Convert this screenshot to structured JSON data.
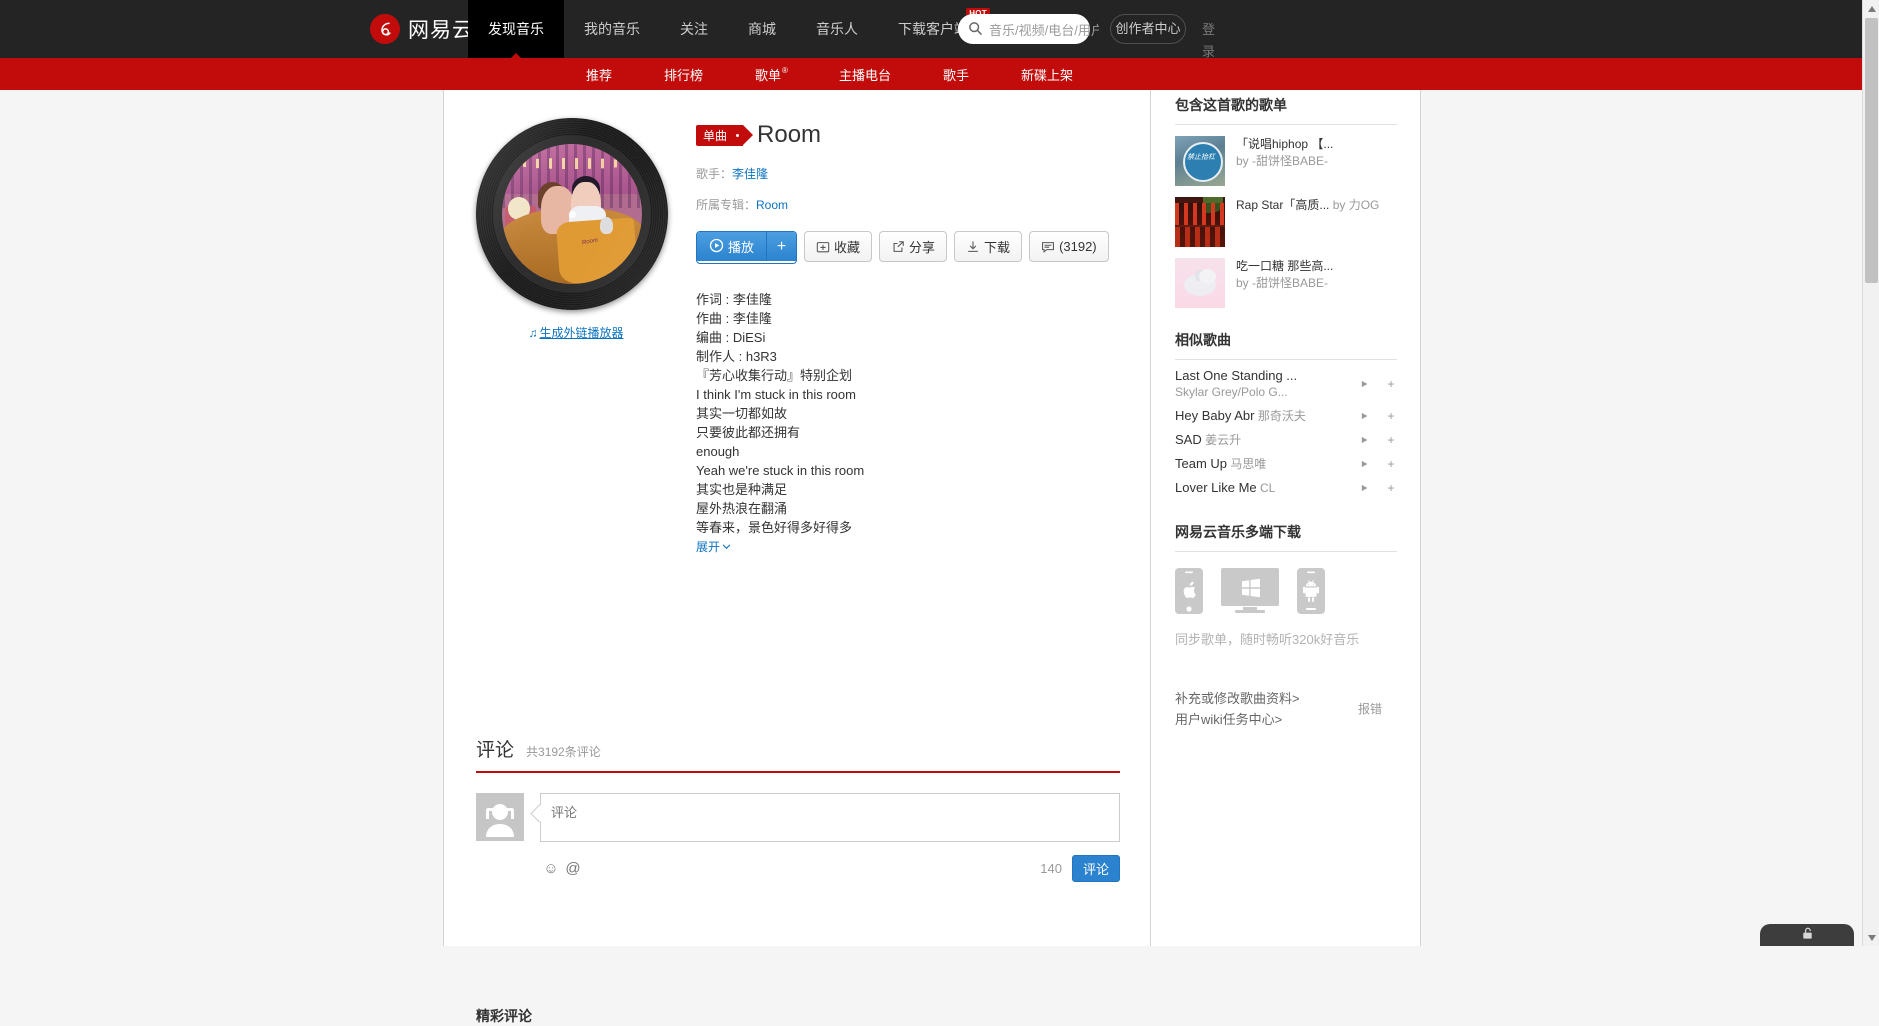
{
  "header": {
    "logo_text": "网易云音乐",
    "nav": [
      {
        "label": "发现音乐",
        "active": true,
        "hot": false
      },
      {
        "label": "我的音乐",
        "active": false,
        "hot": false
      },
      {
        "label": "关注",
        "active": false,
        "hot": false
      },
      {
        "label": "商城",
        "active": false,
        "hot": false
      },
      {
        "label": "音乐人",
        "active": false,
        "hot": false
      },
      {
        "label": "下载客户端",
        "active": false,
        "hot": true,
        "hot_label": "HOT"
      }
    ],
    "search_placeholder": "音乐/视频/电台/用户",
    "search_value": "",
    "creator_center": "创作者中心",
    "login": "登录"
  },
  "subnav": [
    {
      "label": "推荐",
      "sup": ""
    },
    {
      "label": "排行榜",
      "sup": ""
    },
    {
      "label": "歌单",
      "sup": "®"
    },
    {
      "label": "主播电台",
      "sup": ""
    },
    {
      "label": "歌手",
      "sup": ""
    },
    {
      "label": "新碟上架",
      "sup": ""
    }
  ],
  "song": {
    "tag": "单曲",
    "title": "Room",
    "artist_label": "歌手：",
    "artist": "李佳隆",
    "album_label": "所属专辑：",
    "album": "Room",
    "cover_caption": "Room",
    "outlink": "生成外链播放器",
    "outlink_icon": "music-note-icon",
    "report": "报错"
  },
  "actions": {
    "play": "播放",
    "plus": "+",
    "collect": "收藏",
    "share": "分享",
    "download": "下载",
    "comment_count": "(3192)"
  },
  "lyrics": [
    "作词 : 李佳隆",
    "作曲 : 李佳隆",
    "编曲 : DiESi",
    "制作人 : h3R3",
    "『芳心收集行动』特别企划",
    "I think I'm stuck in this room",
    "其实一切都如故",
    "只要彼此都还拥有",
    "enough",
    "Yeah we're stuck in this room",
    "其实也是种满足",
    "屋外热浪在翻涌",
    "等春来，景色好得多好得多"
  ],
  "expand_label": "展开",
  "comments": {
    "title": "评论",
    "count_text": "共3192条评论",
    "placeholder": "评论",
    "value": "",
    "char_count": "140",
    "submit": "评论",
    "emoji_icon": "emoji-icon",
    "mention_icon": "mention-at-icon",
    "hot_title": "精彩评论"
  },
  "sidebar": {
    "playlists_title": "包含这首歌的歌单",
    "playlists": [
      {
        "name": "「说唱hiphop 【...",
        "by": "by -甜饼怪BABE-",
        "cover": "c1",
        "cover_text": "禁止抬杠"
      },
      {
        "name": "Rap Star「高质...",
        "by": "by 力OG",
        "cover": "c2",
        "cover_text": ""
      },
      {
        "name": "吃一口糖 那些高...",
        "by": "by -甜饼怪BABE-",
        "cover": "c3",
        "cover_text": ""
      }
    ],
    "similar_title": "相似歌曲",
    "similar": [
      {
        "name": "Last One Standing ...",
        "artist": "Skylar Grey/Polo G..."
      },
      {
        "name": "Hey Baby Abr",
        "artist": "那奇沃夫"
      },
      {
        "name": "SAD",
        "artist": "姜云升"
      },
      {
        "name": "Team Up",
        "artist": "马思唯"
      },
      {
        "name": "Lover Like Me",
        "artist": "CL"
      }
    ],
    "download_title": "网易云音乐多端下载",
    "download_note": "同步歌单，随时畅听320k好音乐",
    "download_platforms": [
      "apple-iphone-icon",
      "windows-desktop-icon",
      "android-phone-icon"
    ],
    "wiki_links": [
      "补充或修改歌曲资料>",
      "用户wiki任务中心>"
    ]
  },
  "colors": {
    "brand_red": "#c20c0c",
    "link_blue": "#0c73c2",
    "button_blue": "#2b83cf",
    "header_black": "#242424"
  }
}
